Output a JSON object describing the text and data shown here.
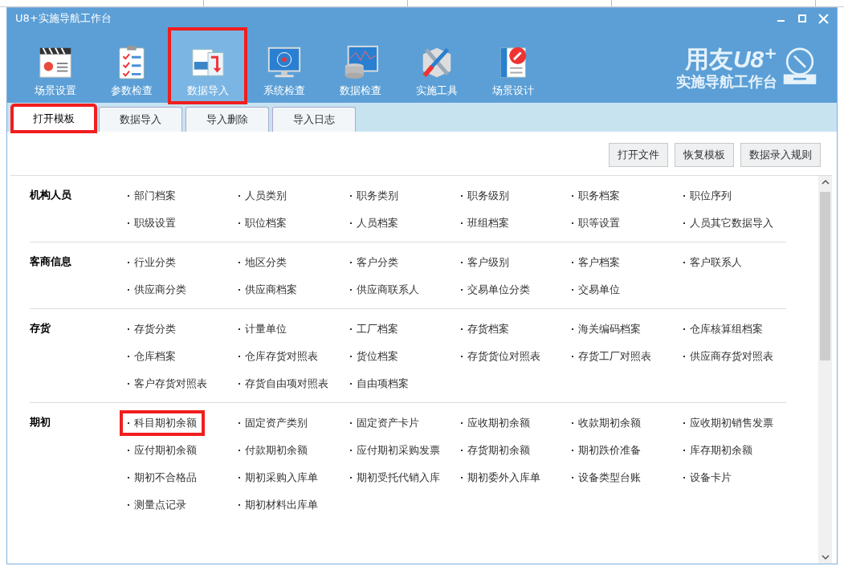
{
  "window": {
    "title": "U8+实施导航工作台"
  },
  "toolbar": [
    {
      "label": "场景设置",
      "kind": "scene",
      "selected": false,
      "highlighted": false
    },
    {
      "label": "参数检查",
      "kind": "checklist",
      "selected": false,
      "highlighted": false
    },
    {
      "label": "数据导入",
      "kind": "import",
      "selected": true,
      "highlighted": true
    },
    {
      "label": "系统检查",
      "kind": "monitor",
      "selected": false,
      "highlighted": false
    },
    {
      "label": "数据检查",
      "kind": "database",
      "selected": false,
      "highlighted": false
    },
    {
      "label": "实施工具",
      "kind": "tools",
      "selected": false,
      "highlighted": false
    },
    {
      "label": "场景设计",
      "kind": "design",
      "selected": false,
      "highlighted": false
    }
  ],
  "logo": {
    "brand": "用友",
    "product": "U8",
    "sup": "+",
    "subtitle": "实施导航工作台"
  },
  "tabs": [
    {
      "label": "打开模板",
      "selected": true,
      "highlighted": true
    },
    {
      "label": "数据导入",
      "selected": false,
      "highlighted": false
    },
    {
      "label": "导入删除",
      "selected": false,
      "highlighted": false
    },
    {
      "label": "导入日志",
      "selected": false,
      "highlighted": false
    }
  ],
  "buttons": [
    "打开文件",
    "恢复模板",
    "数据录入规则"
  ],
  "sections": [
    {
      "title": "机构人员",
      "items": [
        {
          "label": "部门档案",
          "highlighted": false
        },
        {
          "label": "人员类别",
          "highlighted": false
        },
        {
          "label": "职务类别",
          "highlighted": false
        },
        {
          "label": "职务级别",
          "highlighted": false
        },
        {
          "label": "职务档案",
          "highlighted": false
        },
        {
          "label": "职位序列",
          "highlighted": false
        },
        {
          "label": "职级设置",
          "highlighted": false
        },
        {
          "label": "职位档案",
          "highlighted": false
        },
        {
          "label": "人员档案",
          "highlighted": false
        },
        {
          "label": "班组档案",
          "highlighted": false
        },
        {
          "label": "职等设置",
          "highlighted": false
        },
        {
          "label": "人员其它数据导入",
          "highlighted": false
        }
      ]
    },
    {
      "title": "客商信息",
      "items": [
        {
          "label": "行业分类",
          "highlighted": false
        },
        {
          "label": "地区分类",
          "highlighted": false
        },
        {
          "label": "客户分类",
          "highlighted": false
        },
        {
          "label": "客户级别",
          "highlighted": false
        },
        {
          "label": "客户档案",
          "highlighted": false
        },
        {
          "label": "客户联系人",
          "highlighted": false
        },
        {
          "label": "供应商分类",
          "highlighted": false
        },
        {
          "label": "供应商档案",
          "highlighted": false
        },
        {
          "label": "供应商联系人",
          "highlighted": false
        },
        {
          "label": "交易单位分类",
          "highlighted": false
        },
        {
          "label": "交易单位",
          "highlighted": false
        }
      ]
    },
    {
      "title": "存货",
      "items": [
        {
          "label": "存货分类",
          "highlighted": false
        },
        {
          "label": "计量单位",
          "highlighted": false
        },
        {
          "label": "工厂档案",
          "highlighted": false
        },
        {
          "label": "存货档案",
          "highlighted": false
        },
        {
          "label": "海关编码档案",
          "highlighted": false
        },
        {
          "label": "仓库核算组档案",
          "highlighted": false
        },
        {
          "label": "仓库档案",
          "highlighted": false
        },
        {
          "label": "仓库存货对照表",
          "highlighted": false
        },
        {
          "label": "货位档案",
          "highlighted": false
        },
        {
          "label": "存货货位对照表",
          "highlighted": false
        },
        {
          "label": "存货工厂对照表",
          "highlighted": false
        },
        {
          "label": "供应商存货对照表",
          "highlighted": false
        },
        {
          "label": "客户存货对照表",
          "highlighted": false
        },
        {
          "label": "存货自由项对照表",
          "highlighted": false
        },
        {
          "label": "自由项档案",
          "highlighted": false
        }
      ]
    },
    {
      "title": "期初",
      "items": [
        {
          "label": "科目期初余额",
          "highlighted": true
        },
        {
          "label": "固定资产类别",
          "highlighted": false
        },
        {
          "label": "固定资产卡片",
          "highlighted": false
        },
        {
          "label": "应收期初余额",
          "highlighted": false
        },
        {
          "label": "收款期初余额",
          "highlighted": false
        },
        {
          "label": "应收期初销售发票",
          "highlighted": false
        },
        {
          "label": "应付期初余额",
          "highlighted": false
        },
        {
          "label": "付款期初余额",
          "highlighted": false
        },
        {
          "label": "应付期初采购发票",
          "highlighted": false
        },
        {
          "label": "存货期初余额",
          "highlighted": false
        },
        {
          "label": "期初跌价准备",
          "highlighted": false
        },
        {
          "label": "库存期初余额",
          "highlighted": false
        },
        {
          "label": "期初不合格品",
          "highlighted": false
        },
        {
          "label": "期初采购入库单",
          "highlighted": false
        },
        {
          "label": "期初受托代销入库",
          "highlighted": false
        },
        {
          "label": "期初委外入库单",
          "highlighted": false
        },
        {
          "label": "设备类型台账",
          "highlighted": false
        },
        {
          "label": "设备卡片",
          "highlighted": false
        },
        {
          "label": "测量点记录",
          "highlighted": false
        },
        {
          "label": "期初材料出库单",
          "highlighted": false
        }
      ]
    }
  ]
}
